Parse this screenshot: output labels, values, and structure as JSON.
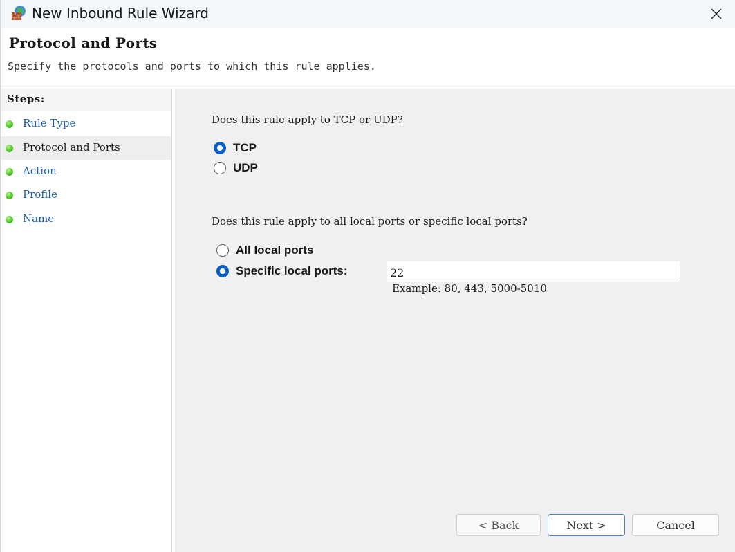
{
  "window": {
    "title": "New Inbound Rule Wizard",
    "icon": "firewall-icon"
  },
  "header": {
    "title": "Protocol and Ports",
    "subtitle": "Specify the protocols and ports to which this rule applies."
  },
  "steps": {
    "title": "Steps:",
    "items": [
      {
        "label": "Rule Type",
        "active": false
      },
      {
        "label": "Protocol and Ports",
        "active": true
      },
      {
        "label": "Action",
        "active": false
      },
      {
        "label": "Profile",
        "active": false
      },
      {
        "label": "Name",
        "active": false
      }
    ]
  },
  "protocol": {
    "question": "Does this rule apply to TCP or UDP?",
    "options": [
      {
        "label": "TCP",
        "checked": true
      },
      {
        "label": "UDP",
        "checked": false
      }
    ]
  },
  "ports": {
    "question": "Does this rule apply to all local ports or specific local ports?",
    "all_label": "All local ports",
    "all_checked": false,
    "specific_label": "Specific local ports:",
    "specific_checked": true,
    "value": "22",
    "example": "Example: 80, 443, 5000-5010"
  },
  "buttons": {
    "back": "< Back",
    "next": "Next >",
    "cancel": "Cancel"
  },
  "colors": {
    "accent": "#0a5fc4",
    "link": "#1d5fae",
    "step_dot": "#5fcf35"
  }
}
